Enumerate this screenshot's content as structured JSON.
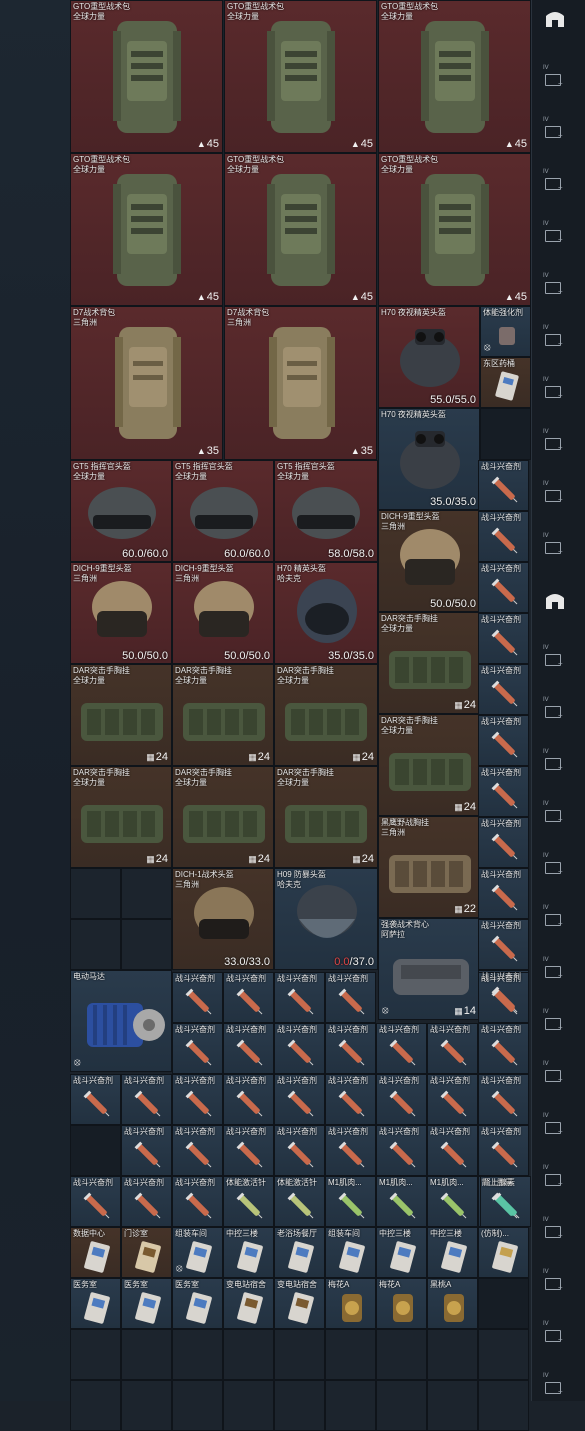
{
  "labels": {
    "gto_backpack": "GTO重型战术包",
    "global_power": "全球力量",
    "d7_backpack": "D7战术背包",
    "delta": "三角洲",
    "h70_nvg": "H70 夜视精英头盔",
    "physique_agent": "体能强化剂",
    "east_medic": "东区药桶",
    "gt5_helmet": "GT5 指挥官头盔",
    "dich9_helmet": "DICH-9重型头盔",
    "h70_elite": "H70 精英头盔",
    "hafu": "哈夫克",
    "combat_stim": "战斗兴奋剂",
    "dar_rig": "DAR突击手胸挂",
    "blackeagle_rig": "黑鹰野战胸挂",
    "dich1_helmet": "DICH-1战术头盔",
    "h09_riot": "H09 防暴头盔",
    "assault_vest": "强袭战术背心",
    "asala": "阿萨拉",
    "electric_motor": "电动马达",
    "physique_activator": "体能激活针",
    "m1_muscle": "M1肌肉...",
    "adrenaline": "肾上腺素",
    "datacenter": "数据中心",
    "door_card": "门诊室",
    "assembly_shop": "组装车间",
    "control_tower": "中控三楼",
    "old_hotel": "老浴场餐厅",
    "control_three": "中控三楼",
    "imitation": "(仿制)...",
    "medical_room": "医务室",
    "substation_dorm": "变电站宿舍",
    "plum_a": "梅花A",
    "black_peach_a": "黑桃A"
  },
  "values": {
    "cap45": "45",
    "cap35": "35",
    "cap24": "24",
    "cap22": "22",
    "cap14": "14",
    "h70_a": "55.0/55.0",
    "h70_b": "35.0/35.0",
    "gt5_a": "60.0/60.0",
    "gt5_b": "60.0/60.0",
    "gt5_c": "58.0/58.0",
    "dich9_a": "50.0/50.0",
    "dich9_b": "50.0/50.0",
    "dich9_c": "50.0/50.0",
    "h70_elite": "35.0/35.0",
    "dich1": "33.0/33.0",
    "h09_cur": "0.0",
    "h09_max": "/37.0"
  },
  "icons": {
    "lock": "lock-icon",
    "weight": "weight-icon",
    "armor": "armor-icon",
    "archive": "archive-icon",
    "container": "container-icon"
  },
  "colors": {
    "red_rarity": "#5a2a2c",
    "brown_rarity": "#453328",
    "blue_rarity": "#2a3b4c",
    "damaged": "#e04545"
  },
  "sidebar": {
    "tags": [
      "IV",
      "IV",
      "IV",
      "IV",
      "IV",
      "IV",
      "IV",
      "IV",
      "IV",
      "IV",
      "IV",
      "IV",
      "IV"
    ]
  }
}
